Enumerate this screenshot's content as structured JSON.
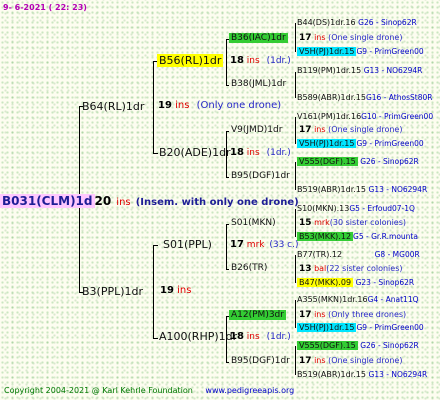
{
  "header": {
    "date": "9-  6-2021 ( 22: 23)"
  },
  "root": {
    "label": "B031(CLM)1d",
    "gen": "20",
    "ins": "ins",
    "note": "(Insem. with only one drone)"
  },
  "gen1": [
    {
      "label": "B64(RL)1dr",
      "gen": "19",
      "ins": "ins",
      "note": "(Only one drone)"
    },
    {
      "label": "B3(PPL)1dr",
      "gen": "19",
      "ins": "ins",
      "note": ""
    }
  ],
  "gen2": [
    {
      "label": "B56(RL)1dr",
      "gen": "18",
      "ins": "ins",
      "note": "(1dr.)"
    },
    {
      "label": "B20(ADE)1dr",
      "gen": "18",
      "ins": "ins",
      "note": "(1dr.)"
    },
    {
      "label": "S01(PPL)",
      "gen": "17",
      "ins": "mrk",
      "note": "(33 c.)"
    },
    {
      "label": "A100(RHP)1dr",
      "gen": "18",
      "ins": "ins",
      "note": "(1dr.)"
    }
  ],
  "gen3": [
    {
      "label": "B36(IAC)1dr",
      "gen": "17",
      "ins": "ins",
      "note": "(One single drone)"
    },
    {
      "label": "B38(JML)1dr",
      "gen": "",
      "ins": "",
      "note": ""
    },
    {
      "label": "V9(JMD)1dr",
      "gen": "17",
      "ins": "ins",
      "note": "(One single drone)"
    },
    {
      "label": "B95(DGF)1dr",
      "gen": "",
      "ins": "",
      "note": ""
    },
    {
      "label": "S01(MKN)",
      "gen": "15",
      "ins": "mrk",
      "note": "(30 sister colonies)"
    },
    {
      "label": "B26(TR)",
      "gen": "13",
      "ins": "bal",
      "note": "(22 sister colonies)"
    },
    {
      "label": "A12(PM)3dr",
      "gen": "17",
      "ins": "ins",
      "note": "(Only three drones)"
    },
    {
      "label": "B95(DGF)1dr",
      "gen": "17",
      "ins": "ins",
      "note": "(One single drone)"
    }
  ],
  "gen4": [
    {
      "label": "B44(DS)1dr.16",
      "loc": "G26 - Sinop62R"
    },
    {
      "label": "V5H(PJ)1dr.15",
      "loc": "G9 - PrimGreen00"
    },
    {
      "label": "B119(PM)1dr.15",
      "loc": "G13 - NO6294R"
    },
    {
      "label": "B589(ABR)1dr.15",
      "loc": "G16 - AthosSt80R"
    },
    {
      "label": "V161(PM)1dr.16",
      "loc": "G10 - PrimGreen00"
    },
    {
      "label": "V5H(PJ)1dr.15",
      "loc": "G9 - PrimGreen00"
    },
    {
      "label": "V555(DGF).15",
      "loc": "G26 - Sinop62R"
    },
    {
      "label": "B519(ABR)1dr.15",
      "loc": "G13 - NO6294R"
    },
    {
      "label": "S10(MKN).13",
      "loc": "G5 - Erfoud07-1Q"
    },
    {
      "label": "B53(MKK).12",
      "loc": "G5 - Gr.R.mounta"
    },
    {
      "label": "B77(TR).12",
      "loc": "G8 - MG00R"
    },
    {
      "label": "B47(MKK).09",
      "loc": "G23 - Sinop62R"
    },
    {
      "label": "A355(MKN)1dr.16",
      "loc": "G4 - Anat11Q"
    },
    {
      "label": "V5H(PJ)1dr.15",
      "loc": "G9 - PrimGreen00"
    },
    {
      "label": "V555(DGF).15",
      "loc": "G26 - Sinop62R"
    },
    {
      "label": "B519(ABR)1dr.15",
      "loc": "G13 - NO6294R"
    }
  ],
  "colors": {
    "yellow": "#ffff00",
    "green": "#33cc33",
    "cyan": "#00e5ff",
    "pink": "#ffc8ff"
  },
  "footer": {
    "copyright": "Copyright 2004-2021 @ Karl Kehrle Foundation",
    "site": "www.pedigreeapis.org"
  }
}
